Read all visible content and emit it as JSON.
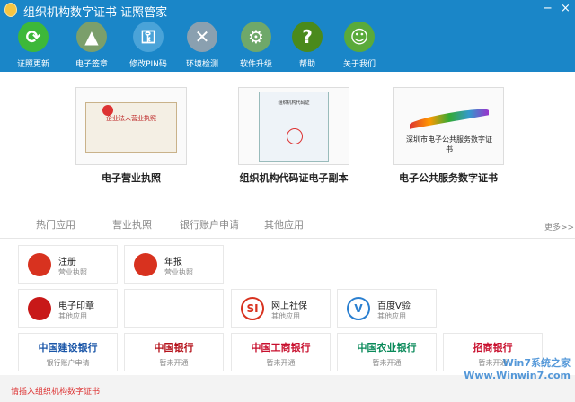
{
  "window": {
    "title": "组织机构数字证书  证照管家",
    "minimize": "−",
    "close": "×"
  },
  "toolbar": [
    {
      "label": "证照更新",
      "icon": "refresh-icon",
      "color": "#3db83a"
    },
    {
      "label": "电子签章",
      "icon": "stamp-icon",
      "color": "#7b9f6b"
    },
    {
      "label": "修改PIN码",
      "icon": "key-icon",
      "color": "#4aa3d8"
    },
    {
      "label": "环境检测",
      "icon": "tools-icon",
      "color": "#8aa0b0"
    },
    {
      "label": "软件升级",
      "icon": "gear-icon",
      "color": "#6fa86a"
    },
    {
      "label": "帮助",
      "icon": "help-icon",
      "color": "#4a8a1c"
    },
    {
      "label": "关于我们",
      "icon": "users-icon",
      "color": "#5aaa3a"
    }
  ],
  "certs": [
    {
      "label": "电子营业执照",
      "image_text": "企业法人营业执照"
    },
    {
      "label": "组织机构代码证电子副本",
      "image_text": "组织机构代码证"
    },
    {
      "label": "电子公共服务数字证书",
      "image_text": "深圳市电子公共服务数字证书"
    }
  ],
  "tabs": [
    "热门应用",
    "营业执照",
    "银行账户申请",
    "其他应用"
  ],
  "more": "更多>>",
  "tiles": [
    {
      "name": "注册",
      "sub": "营业执照",
      "color": "#d8321f"
    },
    {
      "name": "年报",
      "sub": "营业执照",
      "color": "#d8321f"
    },
    {
      "name": "电子印章",
      "sub": "其他应用",
      "color": "#c81818"
    },
    {
      "name": "网上社保",
      "sub": "其他应用",
      "color": "#d8321f",
      "logo": "SI"
    },
    {
      "name": "百度V验",
      "sub": "其他应用",
      "color": "#2a7fd0",
      "logo": "V"
    }
  ],
  "banks": [
    {
      "name": "中国建设银行",
      "sub": "银行账户申请",
      "color": "#1a56a8"
    },
    {
      "name": "中国银行",
      "sub": "暂未开通",
      "color": "#b5121b"
    },
    {
      "name": "中国工商银行",
      "sub": "暂未开通",
      "color": "#c8102e"
    },
    {
      "name": "中国农业银行",
      "sub": "暂未开通",
      "color": "#0a8a5a"
    },
    {
      "name": "招商银行",
      "sub": "暂未开通",
      "color": "#c8102e"
    }
  ],
  "status": "请插入组织机构数字证书",
  "watermark": "Win7系统之家 Www.Winwin7.com"
}
